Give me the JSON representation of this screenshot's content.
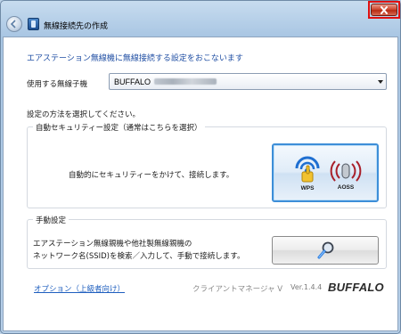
{
  "window": {
    "title": "無線接続先の作成"
  },
  "intro_text": "エアステーション無線機に無線接続する設定をおこないます",
  "device": {
    "label": "使用する無線子機",
    "selected_prefix": "BUFFALO"
  },
  "method_prompt": "設定の方法を選択してください。",
  "auto_group": {
    "title": "自動セキュリティー設定（通常はこちらを選択）",
    "description": "自動的にセキュリティーをかけて、接続します。",
    "wps_label": "WPS",
    "aoss_label": "AOSS"
  },
  "manual_group": {
    "title": "手動設定",
    "description_line1": "エアステーション無線親機や他社製無線親機の",
    "description_line2": "ネットワーク名(SSID)を検索／入力して、手動で接続します。"
  },
  "footer": {
    "options_link": "オプション（上級者向け）",
    "app_name": "クライアントマネージャ V",
    "version": "Ver.1.4.4",
    "brand": "BUFFALO"
  },
  "colors": {
    "accent_blue": "#1f4ea3",
    "close_red": "#cf4a33",
    "highlight_border": "#e01010"
  },
  "icons": {
    "back": "back-arrow-icon",
    "app": "app-icon",
    "close": "close-icon",
    "wps": "wps-icon",
    "aoss": "aoss-icon",
    "manual": "search-wand-icon"
  }
}
